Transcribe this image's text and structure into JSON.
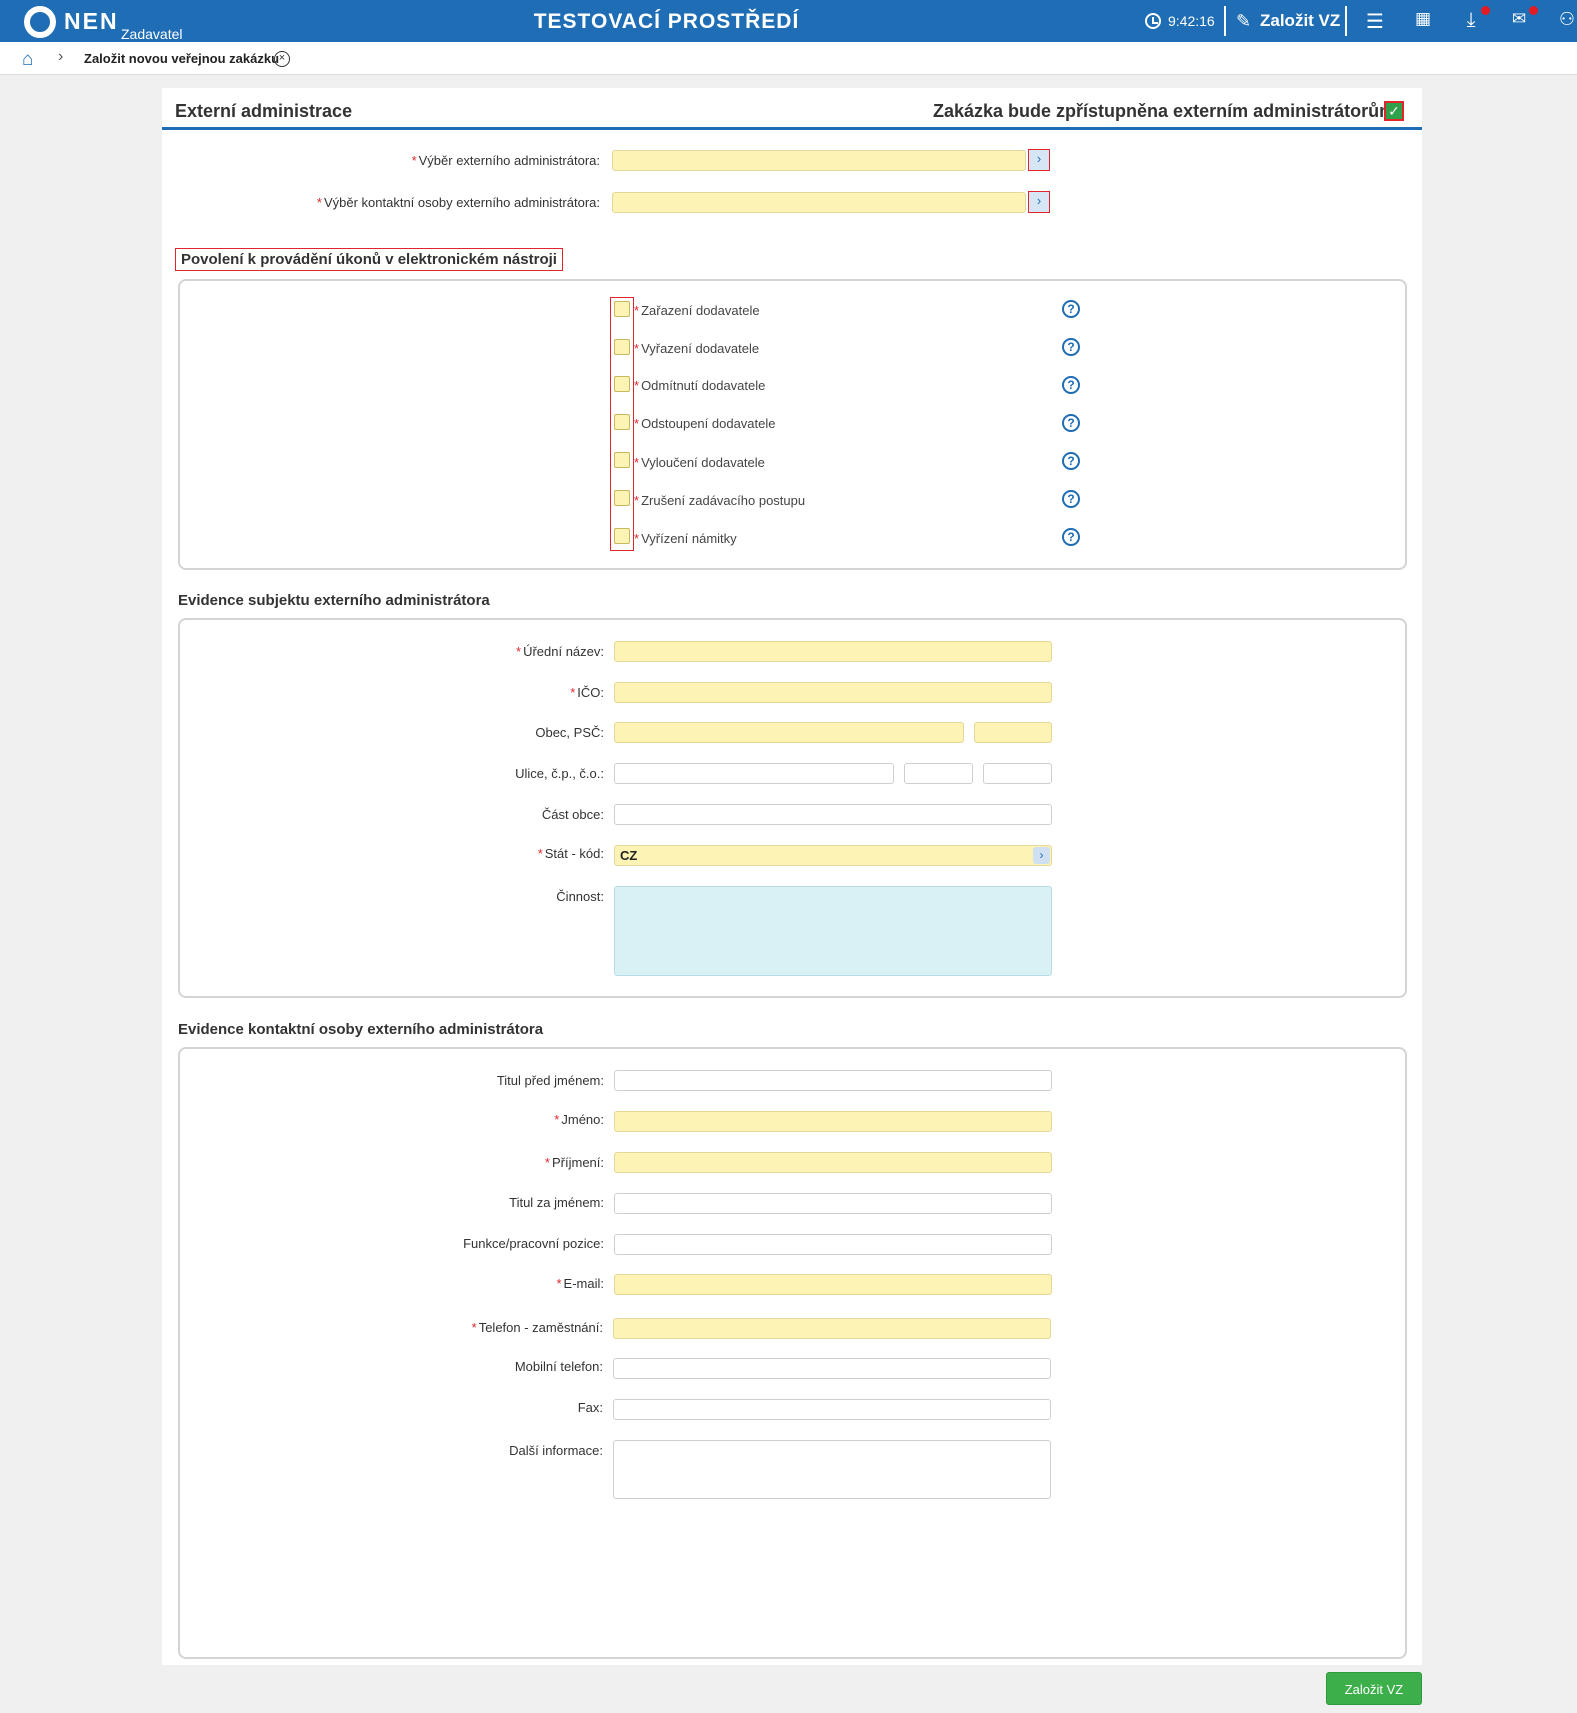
{
  "topbar": {
    "logo_text": "NEN",
    "logo_sub": "Zadavatel",
    "env_title": "TESTOVACÍ PROSTŘEDÍ",
    "time": "9:42:16",
    "create_label": "Založit VZ",
    "icons": [
      "clock-icon",
      "edit-icon",
      "menu-icon",
      "calendar-icon",
      "download-icon",
      "mail-icon",
      "user-icon"
    ]
  },
  "breadcrumb": {
    "item": "Založit novou veřejnou zakázku"
  },
  "panel": {
    "title": "Externí administrace",
    "access_label": "Zakázka bude zpřístupněna externím administrátorům:",
    "access_checked": true
  },
  "selection": {
    "admin_label": "Výběr externího administrátora:",
    "contact_label": "Výběr kontaktní osoby externího administrátora:"
  },
  "permissions": {
    "title": "Povolení k provádění úkonů v elektronickém nástroji",
    "items": [
      "Zařazení dodavatele",
      "Vyřazení dodavatele",
      "Odmítnutí dodavatele",
      "Odstoupení dodavatele",
      "Vyloučení dodavatele",
      "Zrušení zadávacího postupu",
      "Vyřízení námitky"
    ]
  },
  "subject": {
    "title": "Evidence subjektu externího administrátora",
    "official_name": "Úřední název:",
    "ico": "IČO:",
    "city_zip": "Obec, PSČ:",
    "street": "Ulice, č.p., č.o.:",
    "district": "Část obce:",
    "country": "Stát - kód:",
    "country_value": "CZ",
    "activity": "Činnost:"
  },
  "contact": {
    "title": "Evidence kontaktní osoby externího administrátora",
    "title_before": "Titul před jménem:",
    "first_name": "Jméno:",
    "last_name": "Příjmení:",
    "title_after": "Titul za jménem:",
    "position": "Funkce/pracovní pozice:",
    "email": "E-mail:",
    "phone_work": "Telefon - zaměstnání:",
    "mobile": "Mobilní telefon:",
    "fax": "Fax:",
    "other_info": "Další informace:"
  },
  "footer": {
    "submit_label": "Založit VZ"
  },
  "colors": {
    "brand_blue": "#1f6db5",
    "required_yellow": "#fdf3b4",
    "submit_green": "#3cae4a",
    "error_red": "#e0262c"
  }
}
